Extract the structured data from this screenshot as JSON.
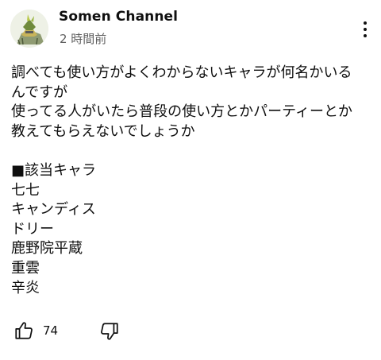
{
  "post": {
    "channel_name": "Somen Channel",
    "timestamp": "2 時間前",
    "avatar_icon": "channel-avatar-icon",
    "menu_icon": "more-vert-icon",
    "body_lines": [
      "調べても使い方がよくわからないキャラが何名かいる",
      "んですが",
      "使ってる人がいたら普段の使い方とかパーティーとか",
      "教えてもらえないでしょうか",
      "",
      "■該当キャラ",
      "七七",
      "キャンディス",
      "ドリー",
      "鹿野院平蔵",
      "重雲",
      "辛炎"
    ],
    "like_icon": "thumbs-up-icon",
    "like_count": "74",
    "dislike_icon": "thumbs-down-icon"
  }
}
